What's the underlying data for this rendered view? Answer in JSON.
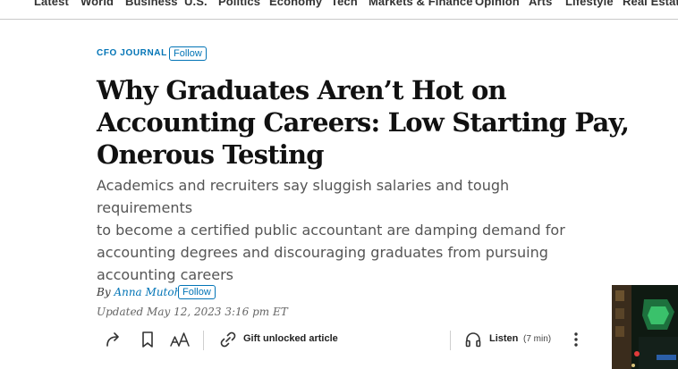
{
  "nav": {
    "items": [
      "Latest",
      "World",
      "Business",
      "U.S.",
      "Politics",
      "Economy",
      "Tech",
      "Markets & Finance",
      "Opinion",
      "Arts",
      "Lifestyle",
      "Real Estate"
    ]
  },
  "article": {
    "kicker": "CFO JOURNAL",
    "follow_label": "Follow",
    "headline_lines": [
      "Why Graduates Aren’t Hot on",
      "Accounting Careers: Low Starting Pay,",
      "Onerous Testing"
    ],
    "dek_lines": [
      "Academics and recruiters say sluggish salaries and tough requirements",
      "to become a certified public accountant are damping demand for",
      "accounting degrees and discouraging graduates from pursuing",
      "accounting careers"
    ],
    "by_prefix": "By",
    "author": "Anna Mutoh",
    "author_follow_label": "Follow",
    "updated": "Updated May 12, 2023 3:16 pm ET"
  },
  "toolbar": {
    "gift_label": "Gift unlocked article",
    "listen_label": "Listen",
    "listen_duration": "(7 min)",
    "icons": [
      "share-icon",
      "bookmark-icon",
      "text-size-icon",
      "link-icon",
      "headphones-icon",
      "more-vertical-icon"
    ]
  },
  "colors": {
    "accent": "#0274b6",
    "headline": "#111111",
    "dek": "#555555",
    "divider": "#cfcfcf"
  }
}
